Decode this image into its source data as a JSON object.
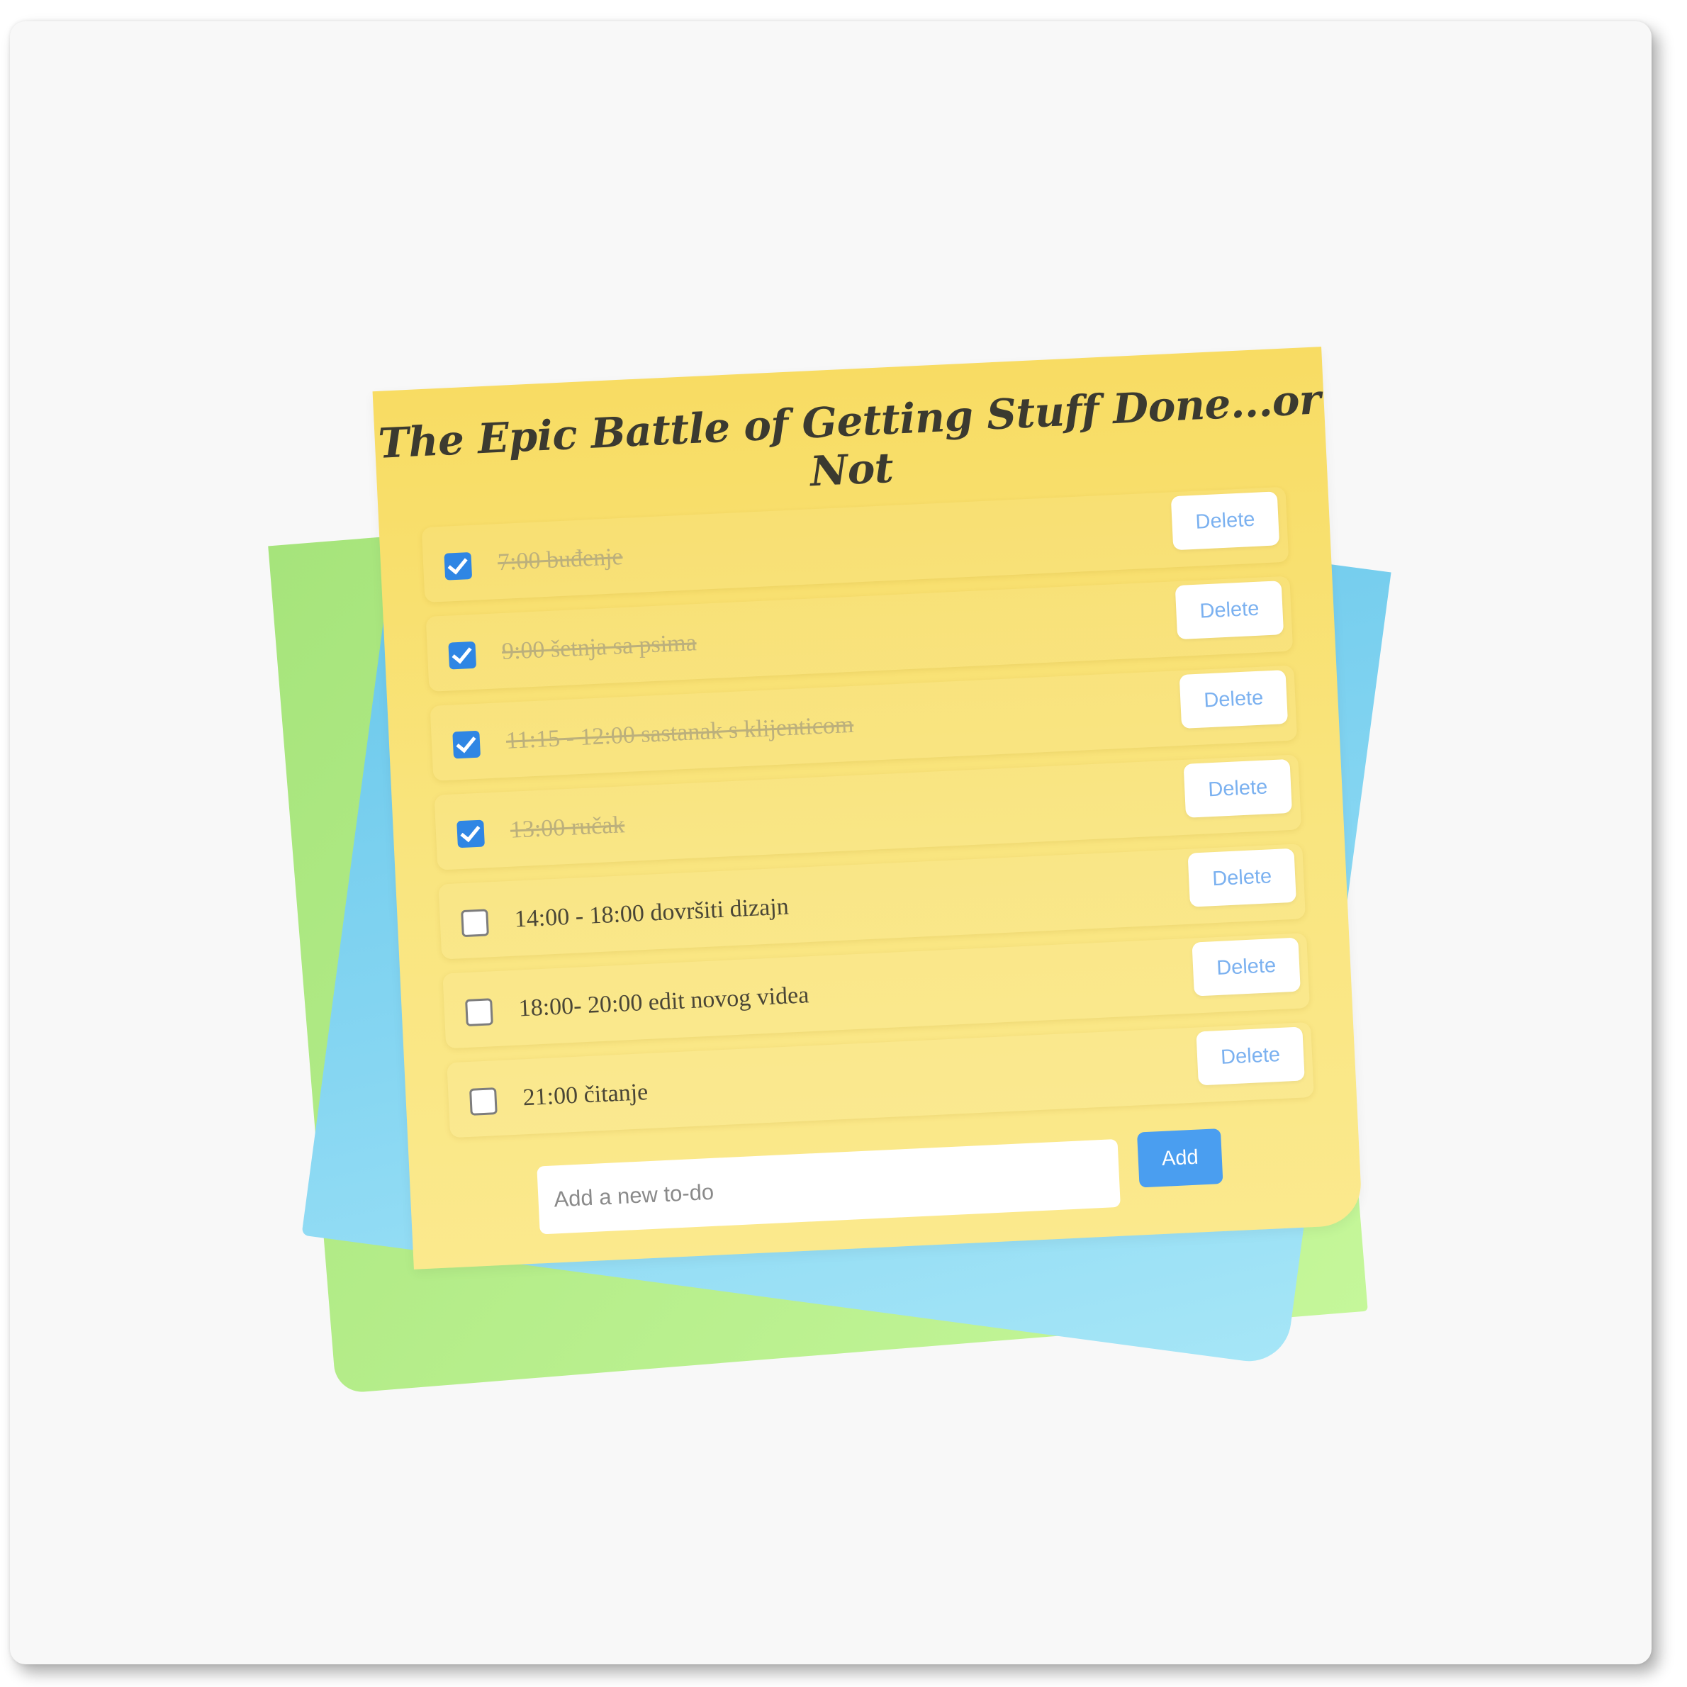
{
  "app": {
    "title": "The Epic Battle of Getting Stuff Done...or Not"
  },
  "colors": {
    "note_yellow": "#f9e27a",
    "note_green": "#b5ed8a",
    "note_blue": "#7fd2f0",
    "checkbox_checked": "#2f86e4",
    "add_button": "#4a9ef0",
    "delete_text": "#7bb1f0"
  },
  "todos": [
    {
      "text": "7:00 buđenje",
      "done": true,
      "delete_label": "Delete"
    },
    {
      "text": "9:00 šetnja sa psima",
      "done": true,
      "delete_label": "Delete"
    },
    {
      "text": "11:15 - 12:00 sastanak s klijenticom",
      "done": true,
      "delete_label": "Delete"
    },
    {
      "text": "13:00 ručak",
      "done": true,
      "delete_label": "Delete"
    },
    {
      "text": "14:00 - 18:00 dovršiti dizajn",
      "done": false,
      "delete_label": "Delete"
    },
    {
      "text": "18:00- 20:00 edit novog videa",
      "done": false,
      "delete_label": "Delete"
    },
    {
      "text": "21:00 čitanje",
      "done": false,
      "delete_label": "Delete"
    }
  ],
  "add_form": {
    "placeholder": "Add a new to-do",
    "value": "",
    "button_label": "Add"
  }
}
